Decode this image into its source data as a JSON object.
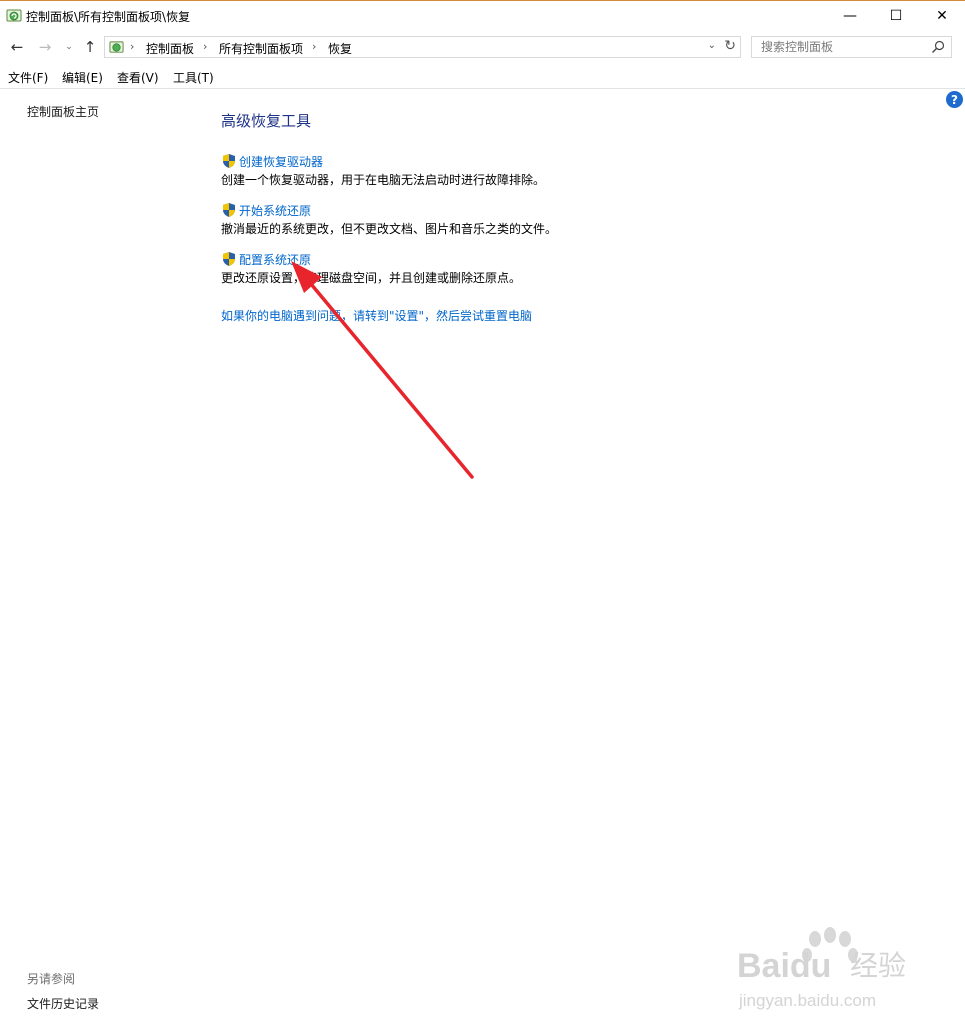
{
  "window": {
    "title": "控制面板\\所有控制面板项\\恢复",
    "minimize": "—",
    "maximize": "☐",
    "close": "✕"
  },
  "nav": {
    "back": "←",
    "forward": "→",
    "recent": "⌄",
    "up": "↑"
  },
  "address": {
    "sep": "›",
    "crumbs": [
      "控制面板",
      "所有控制面板项",
      "恢复"
    ],
    "dropdown": "⌄",
    "refresh": "↻"
  },
  "search": {
    "placeholder": "搜索控制面板"
  },
  "menu": [
    "文件(F)",
    "编辑(E)",
    "查看(V)",
    "工具(T)"
  ],
  "sidebar": {
    "home": "控制面板主页",
    "see_also_title": "另请参阅",
    "see_also_items": [
      "文件历史记录"
    ]
  },
  "help": "?",
  "main": {
    "heading": "高级恢复工具",
    "tasks": [
      {
        "label": "创建恢复驱动器",
        "desc": "创建一个恢复驱动器，用于在电脑无法启动时进行故障排除。"
      },
      {
        "label": "开始系统还原",
        "desc": "撤消最近的系统更改，但不更改文档、图片和音乐之类的文件。"
      },
      {
        "label": "配置系统还原",
        "desc": "更改还原设置，管理磁盘空间，并且创建或删除还原点。"
      }
    ],
    "reset_link": "如果你的电脑遇到问题，请转到\"设置\"，然后尝试重置电脑"
  },
  "watermark": {
    "brand": "Baidu",
    "product": "经验",
    "url": "jingyan.baidu.com"
  },
  "colors": {
    "link": "#0066cc",
    "heading": "#1e3287",
    "annotation_arrow": "#e8242c"
  }
}
